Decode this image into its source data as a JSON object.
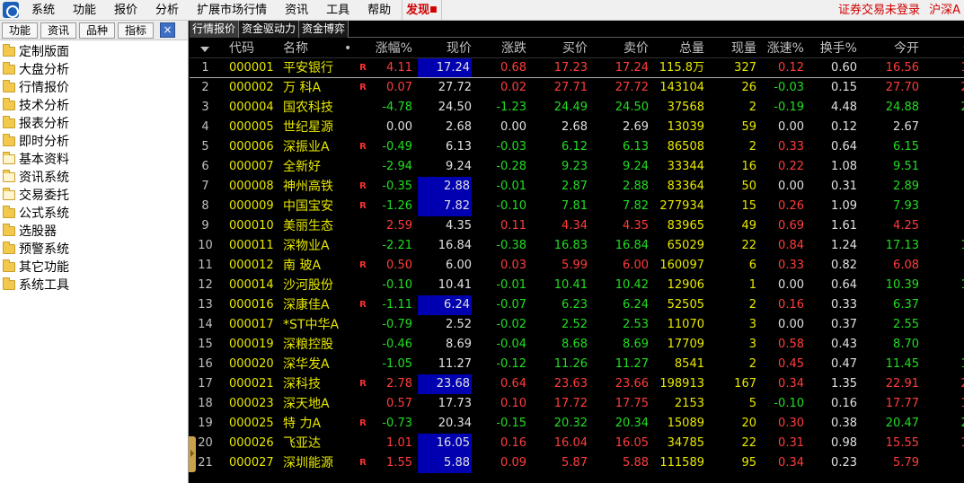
{
  "menu": {
    "items": [
      "系统",
      "功能",
      "报价",
      "分析",
      "扩展市场行情",
      "资讯",
      "工具",
      "帮助"
    ],
    "discover": "发现",
    "status": "证券交易未登录",
    "market": "沪深A"
  },
  "left": {
    "tabs": [
      "功能",
      "资讯",
      "品种",
      "指标"
    ],
    "close": "×",
    "tree": [
      "定制版面",
      "大盘分析",
      "行情报价",
      "技术分析",
      "报表分析",
      "即时分析",
      "基本资料",
      "资讯系统",
      "交易委托",
      "公式系统",
      "选股器",
      "预警系统",
      "其它功能",
      "系统工具"
    ]
  },
  "tabs": [
    "行情报价",
    "资金驱动力",
    "资金博弈"
  ],
  "table": {
    "headers": {
      "code": "代码",
      "name": "名称",
      "dot": "•",
      "pct": "涨幅%",
      "price": "现价",
      "chg": "涨跌",
      "bid": "买价",
      "ask": "卖价",
      "vol": "总量",
      "cur": "现量",
      "spd": "涨速%",
      "turn": "换手%",
      "open": "今开",
      "last": "最"
    },
    "rows": [
      {
        "idx": "1",
        "code": "000001",
        "name": "平安银行",
        "flag": "R",
        "pct": "4.11",
        "price": "17.24",
        "chg": "0.68",
        "bid": "17.23",
        "ask": "17.24",
        "vol": "115.8万",
        "cur": "327",
        "spd": "0.12",
        "turn": "0.60",
        "open": "16.56",
        "last": "17"
      },
      {
        "idx": "2",
        "code": "000002",
        "name": "万 科A",
        "flag": "R",
        "pct": "0.07",
        "price": "27.72",
        "chg": "0.02",
        "bid": "27.71",
        "ask": "27.72",
        "vol": "143104",
        "cur": "26",
        "spd": "-0.03",
        "turn": "0.15",
        "open": "27.70",
        "last": "27"
      },
      {
        "idx": "3",
        "code": "000004",
        "name": "国农科技",
        "flag": "",
        "pct": "-4.78",
        "price": "24.50",
        "chg": "-1.23",
        "bid": "24.49",
        "ask": "24.50",
        "vol": "37568",
        "cur": "2",
        "spd": "-0.19",
        "turn": "4.48",
        "open": "24.88",
        "last": "25"
      },
      {
        "idx": "4",
        "code": "000005",
        "name": "世纪星源",
        "flag": "",
        "pct": "0.00",
        "price": "2.68",
        "chg": "0.00",
        "bid": "2.68",
        "ask": "2.69",
        "vol": "13039",
        "cur": "59",
        "spd": "0.00",
        "turn": "0.12",
        "open": "2.67",
        "last": "2"
      },
      {
        "idx": "5",
        "code": "000006",
        "name": "深振业A",
        "flag": "R",
        "pct": "-0.49",
        "price": "6.13",
        "chg": "-0.03",
        "bid": "6.12",
        "ask": "6.13",
        "vol": "86508",
        "cur": "2",
        "spd": "0.33",
        "turn": "0.64",
        "open": "6.15",
        "last": "6"
      },
      {
        "idx": "6",
        "code": "000007",
        "name": "全新好",
        "flag": "",
        "pct": "-2.94",
        "price": "9.24",
        "chg": "-0.28",
        "bid": "9.23",
        "ask": "9.24",
        "vol": "33344",
        "cur": "16",
        "spd": "0.22",
        "turn": "1.08",
        "open": "9.51",
        "last": "9"
      },
      {
        "idx": "7",
        "code": "000008",
        "name": "神州高铁",
        "flag": "R",
        "pct": "-0.35",
        "price": "2.88",
        "chg": "-0.01",
        "bid": "2.87",
        "ask": "2.88",
        "vol": "83364",
        "cur": "50",
        "spd": "0.00",
        "turn": "0.31",
        "open": "2.89",
        "last": "2"
      },
      {
        "idx": "8",
        "code": "000009",
        "name": "中国宝安",
        "flag": "R",
        "pct": "-1.26",
        "price": "7.82",
        "chg": "-0.10",
        "bid": "7.81",
        "ask": "7.82",
        "vol": "277934",
        "cur": "15",
        "spd": "0.26",
        "turn": "1.09",
        "open": "7.93",
        "last": "7"
      },
      {
        "idx": "9",
        "code": "000010",
        "name": "美丽生态",
        "flag": "",
        "pct": "2.59",
        "price": "4.35",
        "chg": "0.11",
        "bid": "4.34",
        "ask": "4.35",
        "vol": "83965",
        "cur": "49",
        "spd": "0.69",
        "turn": "1.61",
        "open": "4.25",
        "last": "4"
      },
      {
        "idx": "10",
        "code": "000011",
        "name": "深物业A",
        "flag": "",
        "pct": "-2.21",
        "price": "16.84",
        "chg": "-0.38",
        "bid": "16.83",
        "ask": "16.84",
        "vol": "65029",
        "cur": "22",
        "spd": "0.84",
        "turn": "1.24",
        "open": "17.13",
        "last": "17"
      },
      {
        "idx": "11",
        "code": "000012",
        "name": "南 玻A",
        "flag": "R",
        "pct": "0.50",
        "price": "6.00",
        "chg": "0.03",
        "bid": "5.99",
        "ask": "6.00",
        "vol": "160097",
        "cur": "6",
        "spd": "0.33",
        "turn": "0.82",
        "open": "6.08",
        "last": "6"
      },
      {
        "idx": "12",
        "code": "000014",
        "name": "沙河股份",
        "flag": "",
        "pct": "-0.10",
        "price": "10.41",
        "chg": "-0.01",
        "bid": "10.41",
        "ask": "10.42",
        "vol": "12906",
        "cur": "1",
        "spd": "0.00",
        "turn": "0.64",
        "open": "10.39",
        "last": "10"
      },
      {
        "idx": "13",
        "code": "000016",
        "name": "深康佳A",
        "flag": "R",
        "pct": "-1.11",
        "price": "6.24",
        "chg": "-0.07",
        "bid": "6.23",
        "ask": "6.24",
        "vol": "52505",
        "cur": "2",
        "spd": "0.16",
        "turn": "0.33",
        "open": "6.37",
        "last": "6"
      },
      {
        "idx": "14",
        "code": "000017",
        "name": "*ST中华A",
        "flag": "",
        "pct": "-0.79",
        "price": "2.52",
        "chg": "-0.02",
        "bid": "2.52",
        "ask": "2.53",
        "vol": "11070",
        "cur": "3",
        "spd": "0.00",
        "turn": "0.37",
        "open": "2.55",
        "last": "2"
      },
      {
        "idx": "15",
        "code": "000019",
        "name": "深粮控股",
        "flag": "",
        "pct": "-0.46",
        "price": "8.69",
        "chg": "-0.04",
        "bid": "8.68",
        "ask": "8.69",
        "vol": "17709",
        "cur": "3",
        "spd": "0.58",
        "turn": "0.43",
        "open": "8.70",
        "last": "8"
      },
      {
        "idx": "16",
        "code": "000020",
        "name": "深华发A",
        "flag": "",
        "pct": "-1.05",
        "price": "11.27",
        "chg": "-0.12",
        "bid": "11.26",
        "ask": "11.27",
        "vol": "8541",
        "cur": "2",
        "spd": "0.45",
        "turn": "0.47",
        "open": "11.45",
        "last": "11"
      },
      {
        "idx": "17",
        "code": "000021",
        "name": "深科技",
        "flag": "R",
        "pct": "2.78",
        "price": "23.68",
        "chg": "0.64",
        "bid": "23.63",
        "ask": "23.66",
        "vol": "198913",
        "cur": "167",
        "spd": "0.34",
        "turn": "1.35",
        "open": "22.91",
        "last": "23"
      },
      {
        "idx": "18",
        "code": "000023",
        "name": "深天地A",
        "flag": "",
        "pct": "0.57",
        "price": "17.73",
        "chg": "0.10",
        "bid": "17.72",
        "ask": "17.75",
        "vol": "2153",
        "cur": "5",
        "spd": "-0.10",
        "turn": "0.16",
        "open": "17.77",
        "last": "17"
      },
      {
        "idx": "19",
        "code": "000025",
        "name": "特 力A",
        "flag": "R",
        "pct": "-0.73",
        "price": "20.34",
        "chg": "-0.15",
        "bid": "20.32",
        "ask": "20.34",
        "vol": "15089",
        "cur": "20",
        "spd": "0.30",
        "turn": "0.38",
        "open": "20.47",
        "last": "20"
      },
      {
        "idx": "20",
        "code": "000026",
        "name": "飞亚达",
        "flag": "",
        "pct": "1.01",
        "price": "16.05",
        "chg": "0.16",
        "bid": "16.04",
        "ask": "16.05",
        "vol": "34785",
        "cur": "22",
        "spd": "0.31",
        "turn": "0.98",
        "open": "15.55",
        "last": "16"
      },
      {
        "idx": "21",
        "code": "000027",
        "name": "深圳能源",
        "flag": "R",
        "pct": "1.55",
        "price": "5.88",
        "chg": "0.09",
        "bid": "5.87",
        "ask": "5.88",
        "vol": "111589",
        "cur": "95",
        "spd": "0.34",
        "turn": "0.23",
        "open": "5.79",
        "last": "5"
      }
    ]
  },
  "colors": {
    "up": "#ff3c3c",
    "down": "#22dd22",
    "flat": "#e0e0e0",
    "highlight": "#0000b0"
  }
}
